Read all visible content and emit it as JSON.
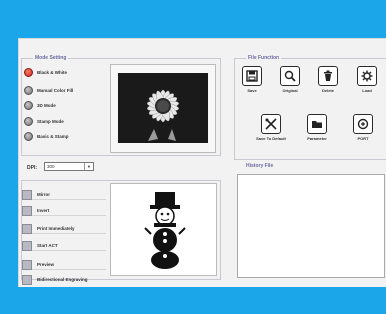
{
  "modes": {
    "title": "Mode Setting",
    "items": [
      {
        "label": "Black & White",
        "selected": true
      },
      {
        "label": "Manual Color Fill",
        "selected": false
      },
      {
        "label": "3D Mode",
        "selected": false
      },
      {
        "label": "Stamp Mode",
        "selected": false
      },
      {
        "label": "Basic & Stamp",
        "selected": false
      }
    ]
  },
  "dpi": {
    "label": "DPI:",
    "value": "300"
  },
  "options": [
    {
      "label": "Mirror"
    },
    {
      "label": "Invert"
    },
    {
      "label": "Print Immediately"
    },
    {
      "label": "Start ACT"
    },
    {
      "label": "Preview"
    },
    {
      "label": "Bidirectional Engraving"
    }
  ],
  "file_function": {
    "title": "File Function",
    "tools": [
      {
        "label": "Save",
        "icon": "save-icon"
      },
      {
        "label": "Original",
        "icon": "magnifier-icon"
      },
      {
        "label": "Delete",
        "icon": "trash-icon"
      },
      {
        "label": "Load",
        "icon": "load-gear-icon"
      },
      {
        "label": "Save To Default",
        "icon": "tools-icon"
      },
      {
        "label": "Parameter",
        "icon": "folder-icon"
      },
      {
        "label": "PORT",
        "icon": "port-icon"
      }
    ]
  },
  "history": {
    "title": "History File"
  },
  "colors": {
    "background": "#1aa6e8",
    "panel": "#f2f2f2",
    "accent": "#c0281a"
  }
}
